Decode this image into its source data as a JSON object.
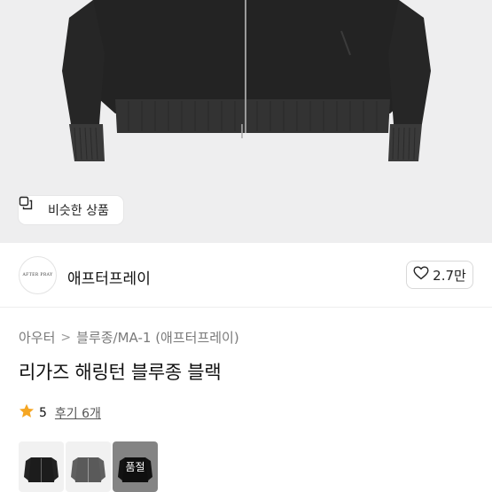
{
  "product_image": {
    "similar_button_label": "비슷한 상품"
  },
  "brand": {
    "logo_text": "AFTER PRAY",
    "name": "애프터프레이"
  },
  "like": {
    "count": "2.7만"
  },
  "breadcrumb": {
    "category": "아우터",
    "subcategory": "블루종/MA-1 (애프터프레이)"
  },
  "product": {
    "title": "리가즈 해링턴 블루종 블랙"
  },
  "rating": {
    "score": "5",
    "reviews_label": "후기 6개",
    "star_color": "#f5a623"
  },
  "variants": [
    {
      "color_name": "black",
      "swatch": "#1c1c1c",
      "sold_out": false
    },
    {
      "color_name": "grey",
      "swatch": "#5a5a5a",
      "sold_out": false
    },
    {
      "color_name": "black",
      "swatch": "#1c1c1c",
      "sold_out": true,
      "sold_out_label": "품절"
    }
  ],
  "icons": [
    "copy-icon",
    "heart-icon",
    "chevron-right-icon",
    "star-icon"
  ]
}
